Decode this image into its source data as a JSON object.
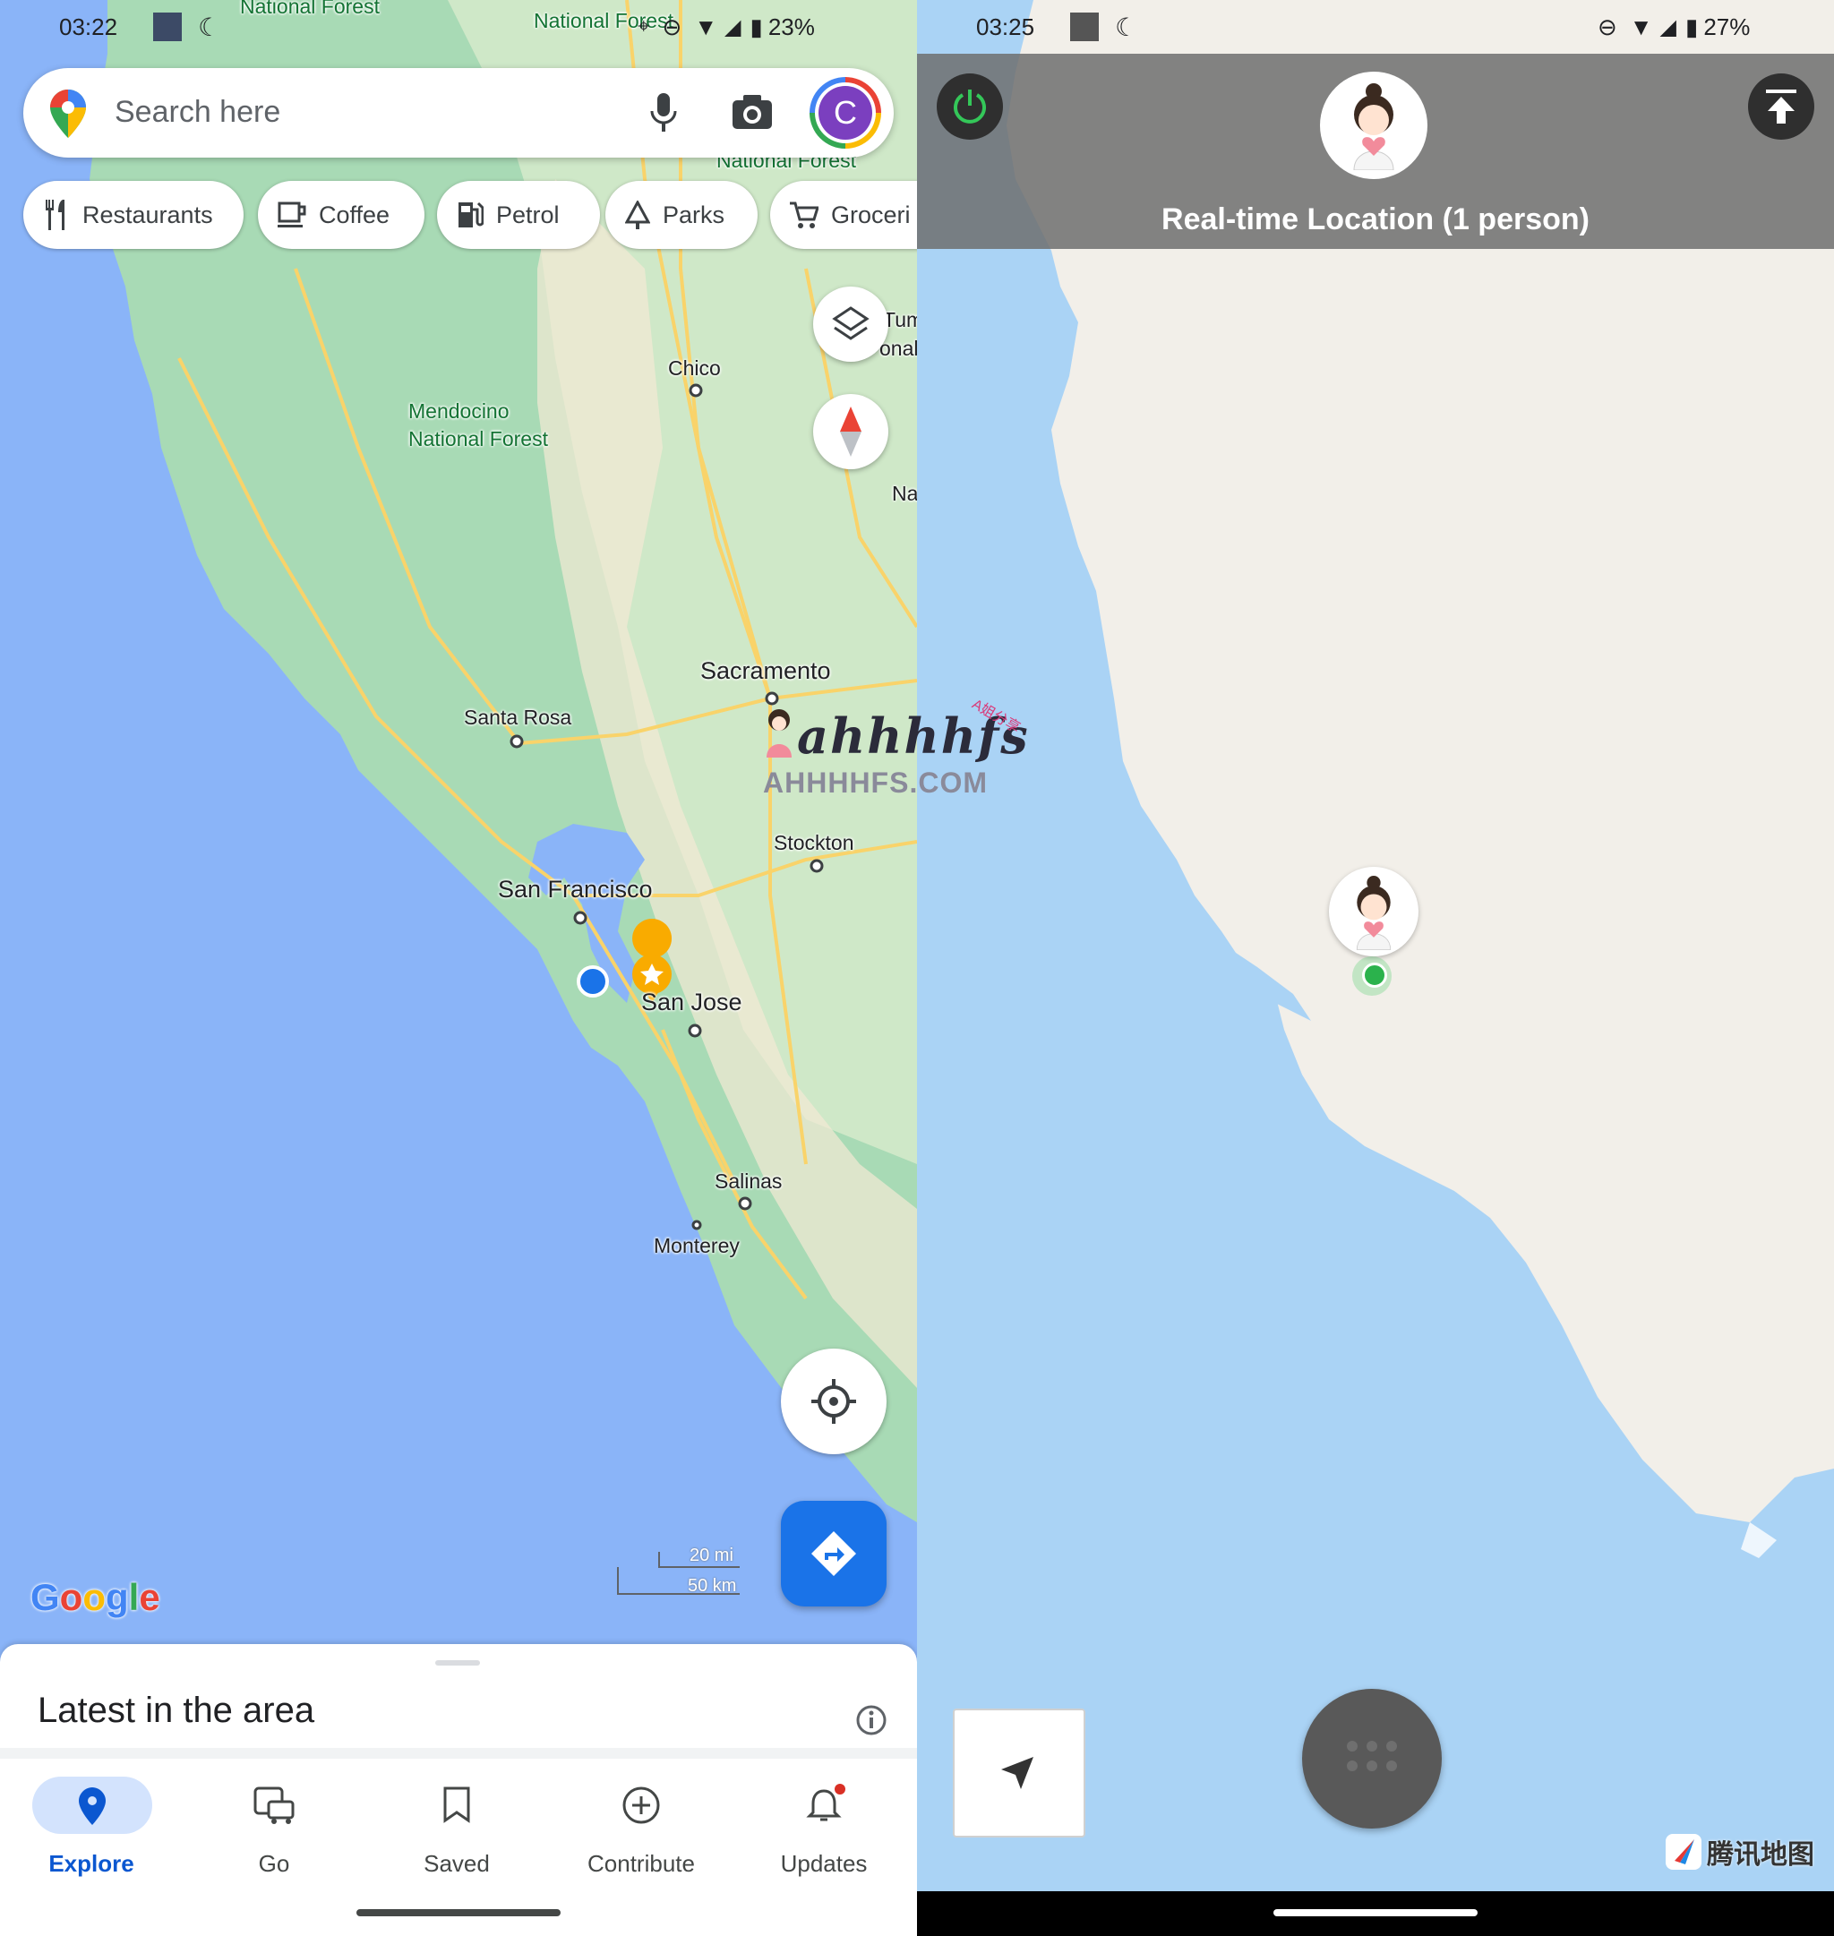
{
  "left": {
    "status": {
      "time": "03:22",
      "battery": "23%"
    },
    "search": {
      "placeholder": "Search here",
      "avatar_letter": "C"
    },
    "chips": [
      "Restaurants",
      "Coffee",
      "Petrol",
      "Parks",
      "Groceri"
    ],
    "map_labels": {
      "national_forest_top1": "National Forest",
      "national_forest_top2": "National Forest",
      "national_forest_top3": "National Forest",
      "chico": "Chico",
      "mendocino": "Mendocino",
      "mendocino2": "National Forest",
      "sacramento": "Sacramento",
      "santa_rosa": "Santa Rosa",
      "stockton": "Stockton",
      "san_francisco": "San Francisco",
      "san_jose": "San Jose",
      "salinas": "Salinas",
      "monterey": "Monterey",
      "edge1": "Tum",
      "edge2": "onal",
      "edge3": "Na"
    },
    "scale": {
      "mi": "20 mi",
      "km": "50 km"
    },
    "brand": "Google",
    "sheet_title": "Latest in the area",
    "nav": [
      {
        "label": "Explore",
        "icon": "pin-icon",
        "active": true
      },
      {
        "label": "Go",
        "icon": "commute-icon",
        "active": false
      },
      {
        "label": "Saved",
        "icon": "bookmark-icon",
        "active": false
      },
      {
        "label": "Contribute",
        "icon": "add-circle-icon",
        "active": false
      },
      {
        "label": "Updates",
        "icon": "bell-icon",
        "active": false
      }
    ]
  },
  "right": {
    "status": {
      "time": "03:25",
      "battery": "27%"
    },
    "title": "Real-time Location (1 person)",
    "brand": "腾讯地图"
  },
  "watermark": {
    "text": "ahhhhfs",
    "sub": "AHHHHFS.COM",
    "tag": "A姐分享"
  },
  "colors": {
    "water_left": "#8ab4f8",
    "land_left": "#a8dab5",
    "water_right": "#aad3f5",
    "land_right": "#f2efe9",
    "accent": "#1a73e8"
  }
}
